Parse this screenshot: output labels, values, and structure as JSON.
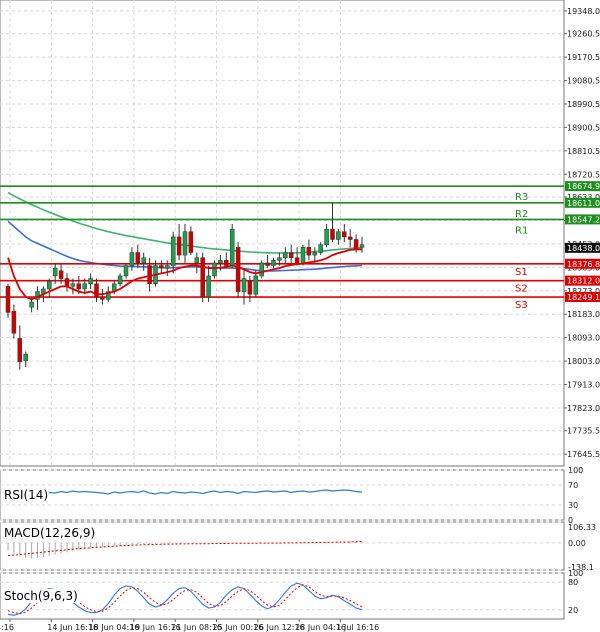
{
  "colors": {
    "background": "#ffffff",
    "grid": "#d8d8d8",
    "candle_up": "#1e9e50",
    "candle_down": "#d00000",
    "ma_fast": "#e00000",
    "ma_mid": "#3a6fd8",
    "ma_slow": "#3cb371",
    "resistance": "#1e8e1e",
    "support": "#e00000",
    "rsi_line": "#2f7ed8",
    "macd_hist": "#aaaaaa",
    "macd_signal": "#e00000",
    "stoch_main": "#2f7ed8",
    "stoch_signal": "#e00000"
  },
  "chart_data": [
    {
      "type": "candlestick",
      "ylim": [
        17600.0,
        19390.0
      ],
      "y_ticks": [
        "19348.0",
        "19260.5",
        "19170.5",
        "19080.5",
        "18990.5",
        "18900.5",
        "18810.5",
        "18720.5",
        "18633.0",
        "18543.0",
        "18453.0",
        "18363.0",
        "18273.0",
        "18183.0",
        "18093.0",
        "18003.0",
        "17913.0",
        "17823.0",
        "17735.5",
        "17645.5"
      ],
      "x_ticks": [
        "4:16",
        "14 Jun 16:16",
        "18 Jun 04:16",
        "19 Jun 16:16",
        "21 Jun 08:16",
        "25 Jun 00:16",
        "26 Jun 12:16",
        "28 Jun 04:16",
        "1 Jul 16:16"
      ],
      "candles": [
        {
          "o": 18290,
          "h": 18300,
          "l": 18170,
          "c": 18190
        },
        {
          "o": 18195,
          "h": 18220,
          "l": 18090,
          "c": 18110
        },
        {
          "o": 18090,
          "h": 18140,
          "l": 17970,
          "c": 18000
        },
        {
          "o": 18005,
          "h": 18040,
          "l": 17980,
          "c": 18030
        },
        {
          "o": 18210,
          "h": 18250,
          "l": 18190,
          "c": 18230
        },
        {
          "o": 18240,
          "h": 18290,
          "l": 18200,
          "c": 18270
        },
        {
          "o": 18260,
          "h": 18290,
          "l": 18230,
          "c": 18280
        },
        {
          "o": 18280,
          "h": 18320,
          "l": 18250,
          "c": 18310
        },
        {
          "o": 18330,
          "h": 18380,
          "l": 18300,
          "c": 18360
        },
        {
          "o": 18350,
          "h": 18380,
          "l": 18300,
          "c": 18320
        },
        {
          "o": 18320,
          "h": 18340,
          "l": 18270,
          "c": 18290
        },
        {
          "o": 18290,
          "h": 18320,
          "l": 18260,
          "c": 18300
        },
        {
          "o": 18300,
          "h": 18330,
          "l": 18260,
          "c": 18280
        },
        {
          "o": 18280,
          "h": 18320,
          "l": 18260,
          "c": 18300
        },
        {
          "o": 18300,
          "h": 18340,
          "l": 18280,
          "c": 18320
        },
        {
          "o": 18300,
          "h": 18320,
          "l": 18230,
          "c": 18250
        },
        {
          "o": 18250,
          "h": 18280,
          "l": 18220,
          "c": 18240
        },
        {
          "o": 18240,
          "h": 18290,
          "l": 18230,
          "c": 18270
        },
        {
          "o": 18270,
          "h": 18310,
          "l": 18260,
          "c": 18300
        },
        {
          "o": 18300,
          "h": 18340,
          "l": 18290,
          "c": 18330
        },
        {
          "o": 18330,
          "h": 18380,
          "l": 18320,
          "c": 18370
        },
        {
          "o": 18370,
          "h": 18440,
          "l": 18350,
          "c": 18420
        },
        {
          "o": 18420,
          "h": 18450,
          "l": 18360,
          "c": 18380
        },
        {
          "o": 18380,
          "h": 18420,
          "l": 18350,
          "c": 18400
        },
        {
          "o": 18370,
          "h": 18400,
          "l": 18270,
          "c": 18300
        },
        {
          "o": 18300,
          "h": 18390,
          "l": 18290,
          "c": 18370
        },
        {
          "o": 18370,
          "h": 18390,
          "l": 18340,
          "c": 18360
        },
        {
          "o": 18360,
          "h": 18390,
          "l": 18330,
          "c": 18370
        },
        {
          "o": 18370,
          "h": 18500,
          "l": 18340,
          "c": 18480
        },
        {
          "o": 18480,
          "h": 18530,
          "l": 18390,
          "c": 18410
        },
        {
          "o": 18410,
          "h": 18530,
          "l": 18380,
          "c": 18500
        },
        {
          "o": 18500,
          "h": 18520,
          "l": 18410,
          "c": 18420
        },
        {
          "o": 18380,
          "h": 18420,
          "l": 18340,
          "c": 18400
        },
        {
          "o": 18400,
          "h": 18420,
          "l": 18230,
          "c": 18250
        },
        {
          "o": 18250,
          "h": 18370,
          "l": 18230,
          "c": 18330
        },
        {
          "o": 18330,
          "h": 18390,
          "l": 18320,
          "c": 18380
        },
        {
          "o": 18380,
          "h": 18410,
          "l": 18350,
          "c": 18390
        },
        {
          "o": 18390,
          "h": 18420,
          "l": 18360,
          "c": 18370
        },
        {
          "o": 18370,
          "h": 18530,
          "l": 18360,
          "c": 18510
        },
        {
          "o": 18440,
          "h": 18460,
          "l": 18250,
          "c": 18270
        },
        {
          "o": 18270,
          "h": 18360,
          "l": 18220,
          "c": 18320
        },
        {
          "o": 18310,
          "h": 18330,
          "l": 18230,
          "c": 18260
        },
        {
          "o": 18260,
          "h": 18350,
          "l": 18250,
          "c": 18330
        },
        {
          "o": 18330,
          "h": 18390,
          "l": 18320,
          "c": 18380
        },
        {
          "o": 18380,
          "h": 18410,
          "l": 18360,
          "c": 18370
        },
        {
          "o": 18370,
          "h": 18400,
          "l": 18360,
          "c": 18390
        },
        {
          "o": 18390,
          "h": 18420,
          "l": 18370,
          "c": 18400
        },
        {
          "o": 18400,
          "h": 18440,
          "l": 18380,
          "c": 18420
        },
        {
          "o": 18420,
          "h": 18450,
          "l": 18380,
          "c": 18400
        },
        {
          "o": 18400,
          "h": 18440,
          "l": 18370,
          "c": 18380
        },
        {
          "o": 18380,
          "h": 18450,
          "l": 18370,
          "c": 18440
        },
        {
          "o": 18440,
          "h": 18470,
          "l": 18390,
          "c": 18410
        },
        {
          "o": 18410,
          "h": 18440,
          "l": 18380,
          "c": 18420
        },
        {
          "o": 18420,
          "h": 18460,
          "l": 18410,
          "c": 18450
        },
        {
          "o": 18450,
          "h": 18530,
          "l": 18440,
          "c": 18510
        },
        {
          "o": 18510,
          "h": 18610,
          "l": 18460,
          "c": 18470
        },
        {
          "o": 18470,
          "h": 18510,
          "l": 18450,
          "c": 18500
        },
        {
          "o": 18500,
          "h": 18530,
          "l": 18460,
          "c": 18480
        },
        {
          "o": 18480,
          "h": 18510,
          "l": 18440,
          "c": 18470
        },
        {
          "o": 18470,
          "h": 18490,
          "l": 18420,
          "c": 18430
        },
        {
          "o": 18440,
          "h": 18480,
          "l": 18420,
          "c": 18450
        }
      ],
      "ma_fast": [
        18400,
        18330,
        18280,
        18250,
        18240,
        18250,
        18260,
        18270,
        18280,
        18290,
        18290,
        18280,
        18270,
        18265,
        18270,
        18260,
        18260,
        18265,
        18270,
        18280,
        18295,
        18310,
        18320,
        18325,
        18330,
        18335,
        18340,
        18345,
        18350,
        18360,
        18365,
        18370,
        18370,
        18365,
        18360,
        18360,
        18362,
        18365,
        18370,
        18365,
        18355,
        18345,
        18340,
        18345,
        18350,
        18355,
        18360,
        18368,
        18372,
        18375,
        18378,
        18382,
        18385,
        18390,
        18398,
        18410,
        18418,
        18424,
        18430,
        18432,
        18432
      ],
      "ma_mid": [
        18540,
        18520,
        18500,
        18480,
        18465,
        18455,
        18445,
        18435,
        18425,
        18415,
        18405,
        18397,
        18390,
        18385,
        18382,
        18378,
        18375,
        18372,
        18370,
        18368,
        18367,
        18366,
        18366,
        18365,
        18364,
        18363,
        18362,
        18361,
        18362,
        18363,
        18364,
        18365,
        18365,
        18363,
        18362,
        18361,
        18360,
        18360,
        18361,
        18360,
        18358,
        18355,
        18352,
        18350,
        18349,
        18349,
        18350,
        18351,
        18352,
        18353,
        18354,
        18355,
        18356,
        18358,
        18360,
        18362,
        18364,
        18366,
        18368,
        18369,
        18370
      ],
      "ma_slow": [
        18650,
        18638,
        18626,
        18615,
        18604,
        18594,
        18584,
        18575,
        18566,
        18557,
        18549,
        18541,
        18533,
        18526,
        18519,
        18512,
        18506,
        18500,
        18495,
        18490,
        18485,
        18481,
        18477,
        18473,
        18469,
        18465,
        18461,
        18457,
        18454,
        18451,
        18448,
        18445,
        18442,
        18439,
        18436,
        18434,
        18432,
        18430,
        18428,
        18426,
        18424,
        18422,
        18421,
        18420,
        18419,
        18418,
        18418,
        18418,
        18418,
        18419,
        18420,
        18422,
        18423,
        18425,
        18427,
        18430,
        18432,
        18434,
        18436,
        18437,
        18438
      ],
      "levels": [
        {
          "name": "R3",
          "value": "18674.9",
          "kind": "resistance"
        },
        {
          "name": "R2",
          "value": "18611.0",
          "kind": "resistance"
        },
        {
          "name": "R1",
          "value": "18547.2",
          "kind": "resistance"
        },
        {
          "name": "S1",
          "value": "18376.8",
          "kind": "support"
        },
        {
          "name": "S2",
          "value": "18312.0",
          "kind": "support"
        },
        {
          "name": "S3",
          "value": "18249.1",
          "kind": "support"
        }
      ],
      "current_price": "18438.0",
      "grid": true
    },
    {
      "type": "line",
      "title": "RSI(14)",
      "ylim": [
        0,
        100
      ],
      "y_ticks": [
        "100",
        "70",
        "30",
        "0"
      ],
      "values": [
        50,
        50,
        50,
        53,
        52,
        55,
        56,
        55,
        54,
        57,
        55,
        58,
        56,
        57,
        56,
        55,
        54,
        52,
        56,
        54,
        56,
        57,
        55,
        58,
        54,
        52,
        55,
        53,
        57,
        55,
        54,
        56,
        55,
        53,
        56,
        58,
        55,
        57,
        56,
        53,
        57,
        56,
        55,
        57,
        58,
        56,
        57,
        58,
        55,
        57,
        58,
        56,
        57,
        59,
        60,
        58,
        59,
        60,
        59,
        57,
        56
      ]
    },
    {
      "type": "bar",
      "title": "MACD(12,26,9)",
      "ylim": [
        -138.1,
        106.33
      ],
      "y_ticks": [
        "106.33",
        "0.00",
        "-138.1"
      ],
      "histogram": [
        -40,
        -55,
        -70,
        -78,
        -80,
        -76,
        -72,
        -66,
        -60,
        -54,
        -48,
        -42,
        -37,
        -33,
        -29,
        -26,
        -23,
        -20,
        -17,
        -14,
        -12,
        -10,
        -8,
        -7,
        -6,
        -5,
        -4,
        -3,
        -3,
        -2,
        -2,
        -2,
        -3,
        -3,
        -2,
        -2,
        -1,
        -1,
        0,
        0,
        0,
        -1,
        -1,
        0,
        0,
        0,
        1,
        1,
        1,
        2,
        2,
        3,
        3,
        4,
        4,
        5,
        5,
        6,
        6,
        6,
        6
      ],
      "signal": [
        -65,
        -62,
        -59,
        -56,
        -53,
        -50,
        -47,
        -44,
        -41,
        -38,
        -35,
        -32,
        -29,
        -27,
        -25,
        -23,
        -21,
        -19,
        -17,
        -15,
        -14,
        -12,
        -11,
        -10,
        -9,
        -8,
        -7,
        -6,
        -6,
        -5,
        -5,
        -4,
        -4,
        -4,
        -4,
        -3,
        -3,
        -3,
        -2,
        -2,
        -2,
        -2,
        -2,
        -1,
        -1,
        -1,
        -1,
        0,
        0,
        0,
        1,
        1,
        2,
        2,
        3,
        3,
        4,
        4,
        5,
        6,
        7
      ]
    },
    {
      "type": "line",
      "title": "Stoch(9,6,3)",
      "ylim": [
        0,
        100
      ],
      "y_ticks": [
        "100",
        "80",
        "20"
      ],
      "main": [
        10,
        8,
        12,
        22,
        38,
        52,
        62,
        66,
        64,
        58,
        48,
        36,
        26,
        18,
        14,
        14,
        20,
        34,
        52,
        66,
        72,
        70,
        60,
        46,
        32,
        26,
        30,
        42,
        56,
        66,
        68,
        60,
        46,
        32,
        24,
        26,
        36,
        52,
        64,
        70,
        66,
        54,
        40,
        28,
        22,
        28,
        42,
        58,
        72,
        78,
        74,
        62,
        50,
        44,
        46,
        52,
        48,
        40,
        32,
        24,
        20
      ],
      "signal": [
        18,
        14,
        12,
        15,
        24,
        36,
        48,
        58,
        62,
        62,
        56,
        46,
        36,
        27,
        20,
        16,
        17,
        24,
        36,
        50,
        62,
        68,
        66,
        58,
        46,
        36,
        30,
        33,
        42,
        54,
        62,
        64,
        58,
        46,
        34,
        28,
        29,
        38,
        50,
        60,
        66,
        62,
        52,
        40,
        30,
        26,
        30,
        42,
        56,
        68,
        74,
        70,
        60,
        52,
        48,
        50,
        50,
        46,
        40,
        33,
        26
      ]
    }
  ]
}
